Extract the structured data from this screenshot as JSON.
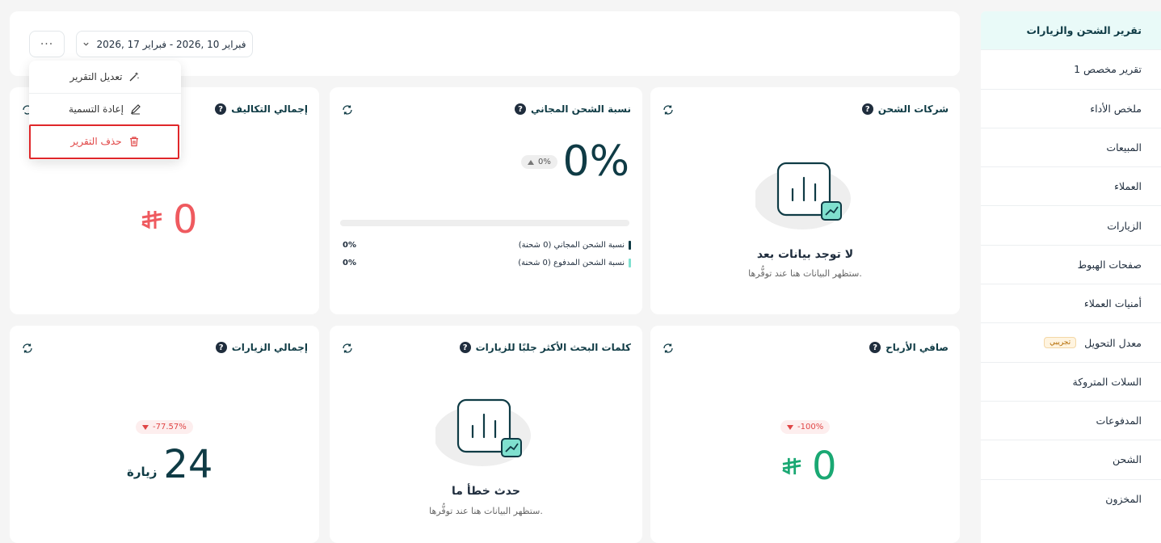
{
  "sidebar": {
    "items": [
      {
        "label": "تقرير الشحن والزيارات",
        "active": true
      },
      {
        "label": "تقرير مخصص 1"
      },
      {
        "label": "ملخص الأداء"
      },
      {
        "label": "المبيعات"
      },
      {
        "label": "العملاء"
      },
      {
        "label": "الزيارات"
      },
      {
        "label": "صفحات الهبوط"
      },
      {
        "label": "أمنيات العملاء"
      },
      {
        "label": "معدل التحويل",
        "badge": "تجريبي"
      },
      {
        "label": "السلات المتروكة"
      },
      {
        "label": "المدفوعات"
      },
      {
        "label": "الشحن"
      },
      {
        "label": "المخزون"
      }
    ]
  },
  "header": {
    "date_range": "فبراير 10 ,2026  -  فبراير 17 ,2026",
    "more_label": "···"
  },
  "menu": {
    "edit": "تعديل التقرير",
    "rename": "إعادة التسمية",
    "delete": "حذف التقرير"
  },
  "cards": {
    "shipping_companies": {
      "title": "شركات الشحن",
      "empty_title": "لا توجد بيانات بعد",
      "empty_sub": "ستظهر البيانات هنا عند توفُّرها."
    },
    "free_shipping": {
      "title": "نسبة الشحن المجاني",
      "value": "0%",
      "change": "0%",
      "progress": 0,
      "legend": [
        {
          "label": "نسبة الشحن المجاني (0 شحنة)",
          "value": "0%",
          "color": "#0f3b45"
        },
        {
          "label": "نسبة الشحن المدفوع (0 شحنة)",
          "value": "0%",
          "color": "#7fe0cf"
        }
      ]
    },
    "total_costs": {
      "title": "إجمالي التكاليف",
      "value": "0",
      "currency": "ⵣ",
      "color": "#ef5a5f"
    },
    "net_profit": {
      "title": "صافي الأرباح",
      "value": "0",
      "currency": "ⵣ",
      "change": "-100%",
      "color": "#1aa873"
    },
    "top_keywords": {
      "title": "كلمات البحث الأكثر جلبًا للزيارات",
      "empty_title": "حدث خطأ ما",
      "empty_sub": "ستظهر البيانات هنا عند توفُّرها."
    },
    "total_visits": {
      "title": "إجمالي الزيارات",
      "value": "24",
      "unit": "زيارة",
      "change": "-77.57%"
    }
  },
  "colors": {
    "accent_dark": "#0f3b45",
    "accent_mint": "#7fe0cf",
    "danger": "#e0272a",
    "positive": "#1aa873"
  }
}
